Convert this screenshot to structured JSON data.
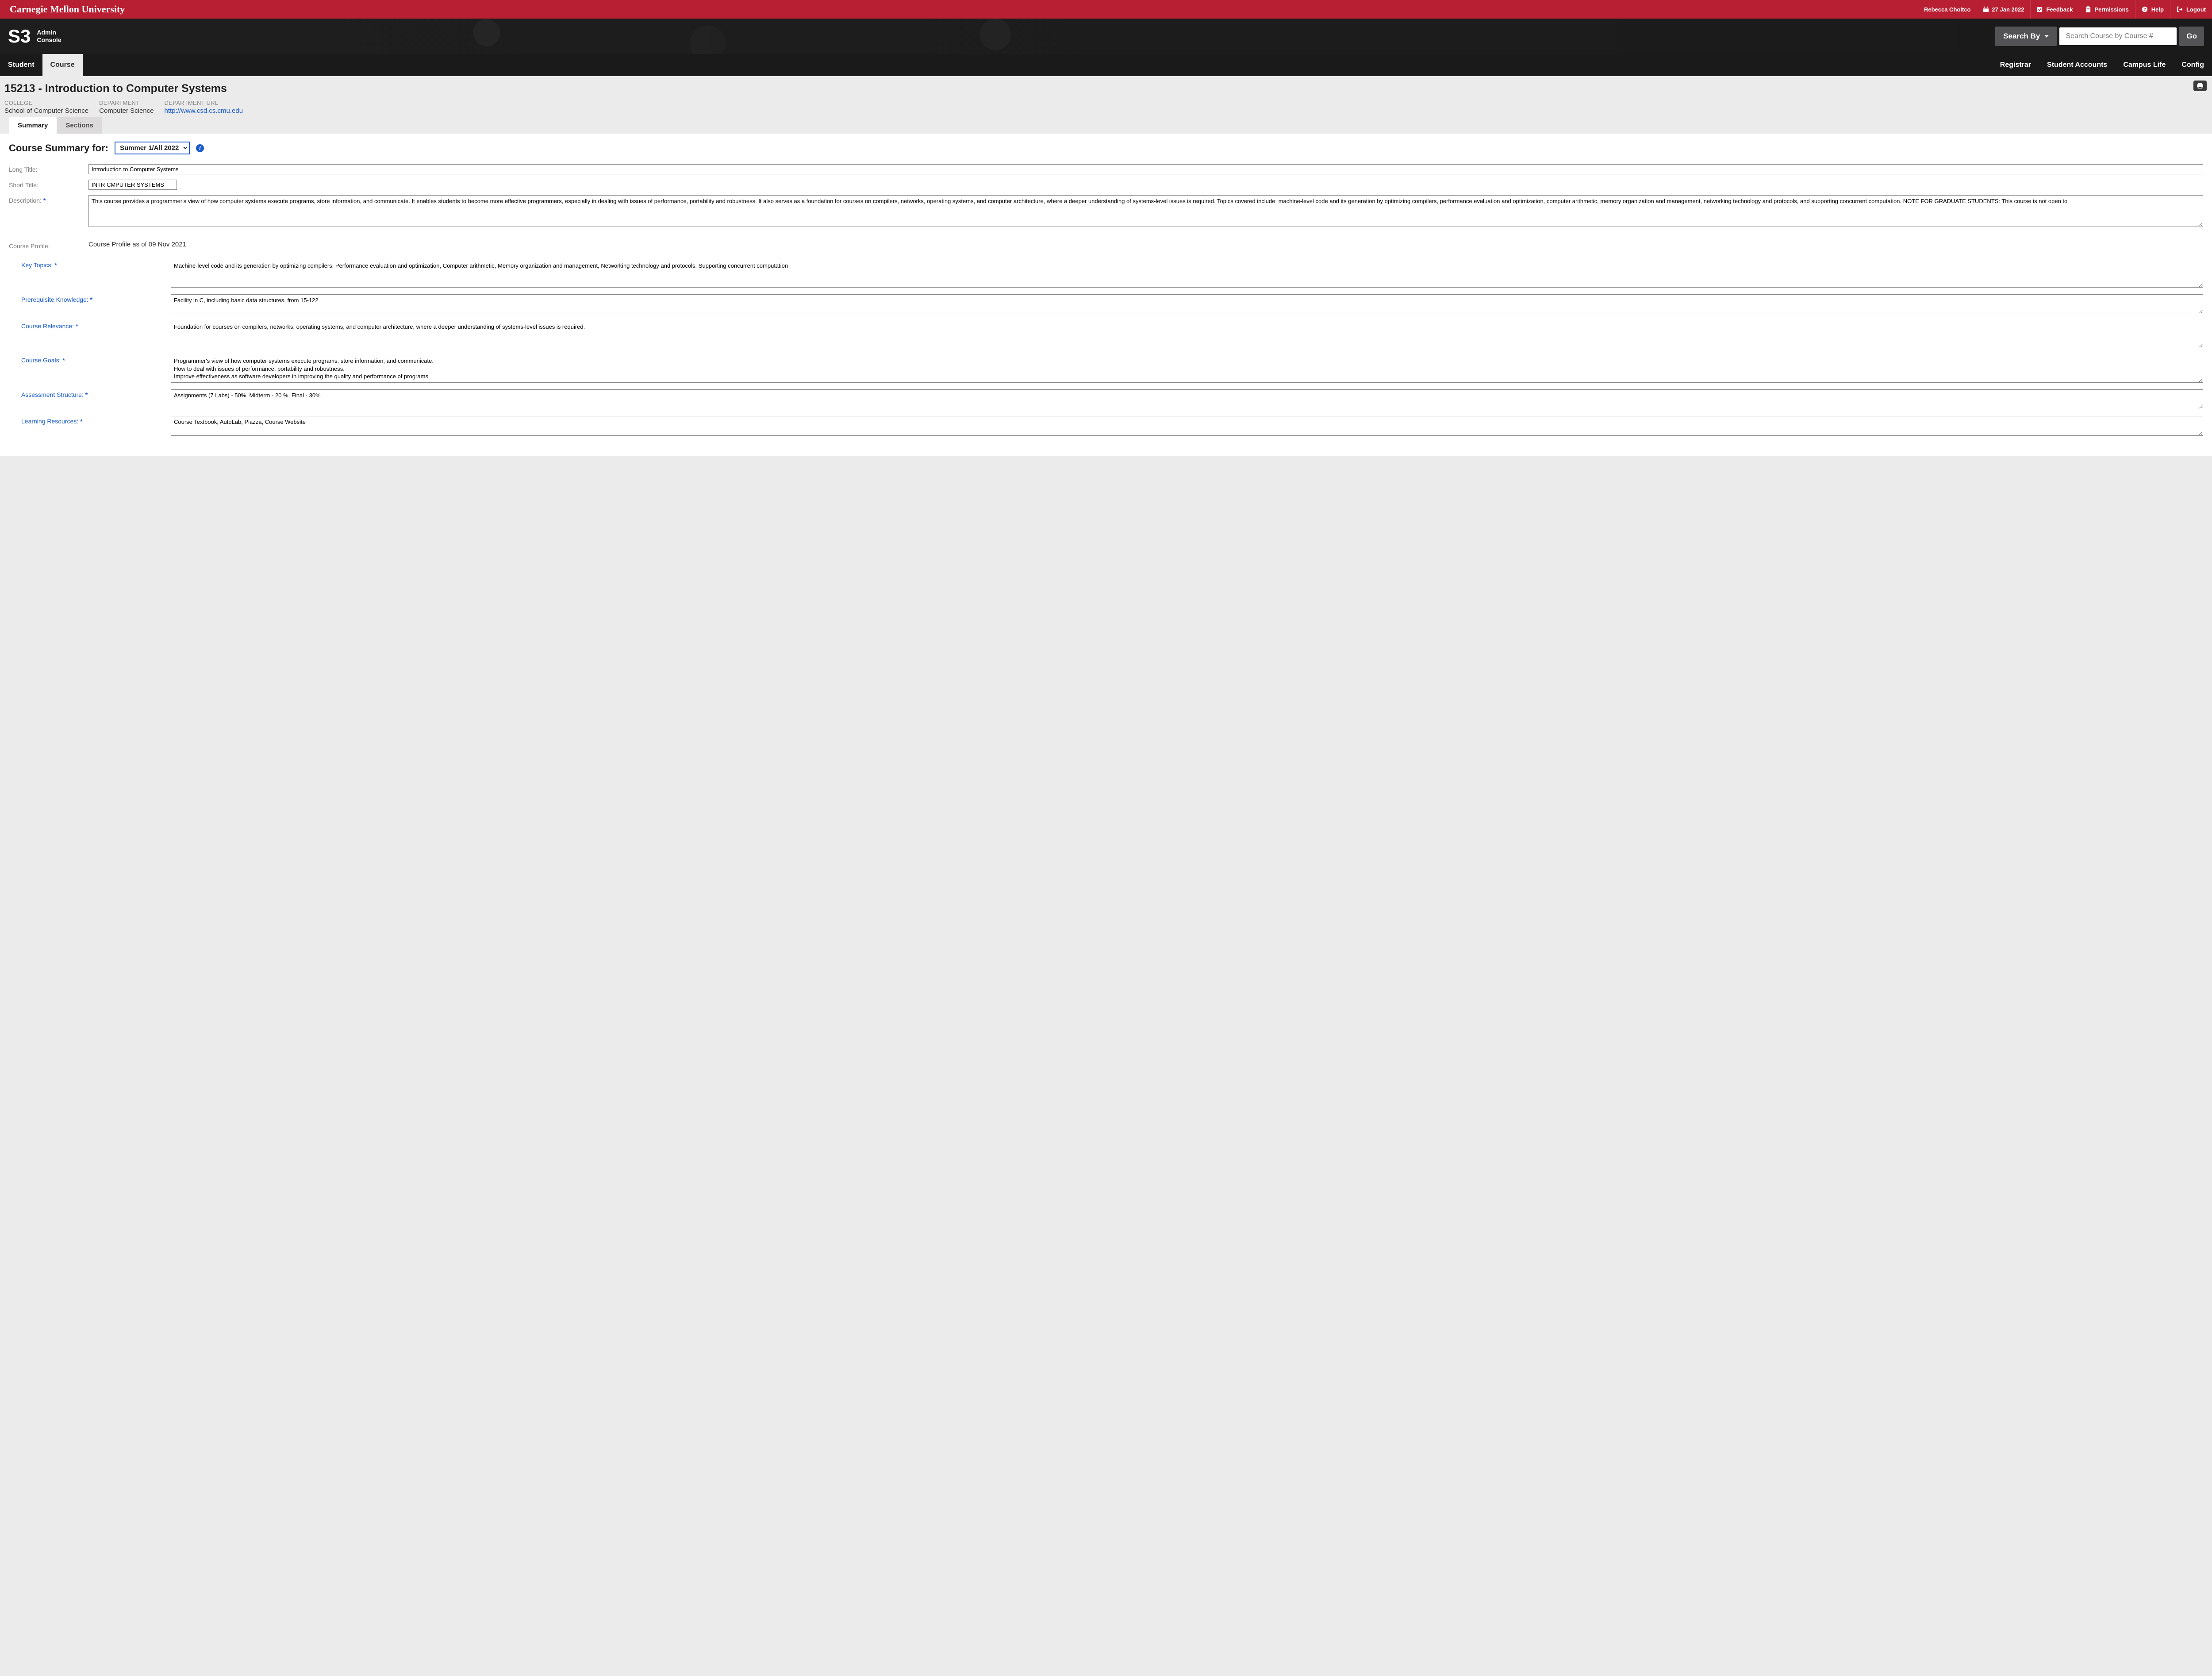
{
  "topbar": {
    "university": "Carnegie Mellon University",
    "user": "Rebecca Choltco",
    "date": "27 Jan 2022",
    "feedback": "Feedback",
    "permissions": "Permissions",
    "help": "Help",
    "logout": "Logout"
  },
  "header": {
    "logo": "S3",
    "subtitle_line1": "Admin",
    "subtitle_line2": "Console",
    "searchby": "Search By",
    "search_placeholder": "Search Course by Course #",
    "go": "Go"
  },
  "nav": {
    "left": [
      "Student",
      "Course"
    ],
    "active_left": "Course",
    "right": [
      "Registrar",
      "Student Accounts",
      "Campus Life",
      "Config"
    ]
  },
  "page": {
    "title": "15213 - Introduction to Computer Systems",
    "meta": {
      "college_label": "COLLEGE",
      "college_value": "School of Computer Science",
      "dept_label": "DEPARTMENT",
      "dept_value": "Computer Science",
      "depturl_label": "DEPARTMENT URL",
      "depturl_value": "http://www.csd.cs.cmu.edu"
    }
  },
  "inner_tabs": {
    "items": [
      "Summary",
      "Sections"
    ],
    "active": "Summary"
  },
  "form": {
    "summary_title": "Course Summary for:",
    "term": "Summer 1/All 2022",
    "labels": {
      "long_title": "Long Title:",
      "short_title": "Short Title:",
      "description": "Description:",
      "course_profile": "Course Profile:",
      "key_topics": "Key Topics:",
      "prereq": "Prerequisite Knowledge:",
      "relevance": "Course Relevance:",
      "goals": "Course Goals:",
      "assessment": "Assessment Structure:",
      "resources": "Learning Resources:"
    },
    "values": {
      "long_title": "Introduction to Computer Systems",
      "short_title": "INTR CMPUTER SYSTEMS",
      "description": "This course provides a programmer's view of how computer systems execute programs, store information, and communicate. It enables students to become more effective programmers, especially in dealing with issues of performance, portability and robustness. It also serves as a foundation for courses on compilers, networks, operating systems, and computer architecture, where a deeper understanding of systems-level issues is required. Topics covered include: machine-level code and its generation by optimizing compilers, performance evaluation and optimization, computer arithmetic, memory organization and management, networking technology and protocols, and supporting concurrent computation. NOTE FOR GRADUATE STUDENTS: This course is not open to",
      "profile_heading": "Course Profile as of 09 Nov 2021",
      "key_topics": "Machine-level code and its generation by optimizing compilers, Performance evaluation and optimization, Computer arithmetic, Memory organization and management, Networking technology and protocols, Supporting concurrent computation",
      "prereq": "Facility in C, including basic data structures, from 15-122",
      "relevance": "Foundation for courses on compilers, networks, operating systems, and computer architecture, where a deeper understanding of systems-level issues is required.",
      "goals": "Programmer's view of how computer systems execute programs, store information, and communicate.\nHow to deal with issues of performance, portability and robustness.\nImprove effectiveness as software developers in improving the quality and performance of programs.",
      "assessment": "Assignments (7 Labs) - 50%, Midterm - 20 %, Final - 30%",
      "resources": "Course Textbook, AutoLab, Piazza, Course Website"
    }
  }
}
